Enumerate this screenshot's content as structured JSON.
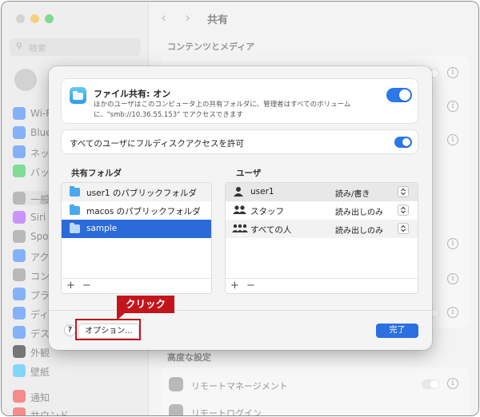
{
  "background": {
    "sidebar": {
      "search_placeholder": "検索",
      "items": [
        "Wi-Fi",
        "Bluet",
        "ネッ",
        "バッ",
        "一般",
        "Siri",
        "Spot",
        "アク",
        "コン",
        "プラ",
        "ディ",
        "デス",
        "外観",
        "壁紙",
        "通知",
        "サウンド"
      ]
    },
    "window_title": "共有",
    "section_content_media": "コンテンツとメディア",
    "section_advanced": "高度な設定",
    "remote_management": "リモートマネージメント",
    "remote_login": "リモートログイン"
  },
  "sheet": {
    "file_sharing": {
      "title": "ファイル共有: オン",
      "description": "ほかのユーザはこのコンピュータ上の共有フォルダに、管理者はすべてのボリュームに、\"smb://10.36.55.153\" でアクセスできます",
      "enabled": true
    },
    "full_disk_access": {
      "label": "すべてのユーザにフルディスクアクセスを許可",
      "enabled": true
    },
    "shared_folders": {
      "heading": "共有フォルダ",
      "items": [
        {
          "label": "user1 のパブリックフォルダ",
          "selected": false
        },
        {
          "label": "macos のパブリックフォルダ",
          "selected": false
        },
        {
          "label": "sample",
          "selected": true
        }
      ]
    },
    "users": {
      "heading": "ユーザ",
      "items": [
        {
          "label": "user1",
          "icon": "person-icon",
          "permission": "読み/書き"
        },
        {
          "label": "スタッフ",
          "icon": "group-icon",
          "permission": "読み出しのみ"
        },
        {
          "label": "すべての人",
          "icon": "everyone-icon",
          "permission": "読み出しのみ"
        }
      ]
    },
    "add_label": "+",
    "remove_label": "−",
    "help_label": "?",
    "options_label": "オプション...",
    "done_label": "完了"
  },
  "annotation": {
    "label": "クリック",
    "color": "#c4141c"
  },
  "colors": {
    "accent": "#2b6fe0",
    "selection": "#2b6ad9"
  }
}
